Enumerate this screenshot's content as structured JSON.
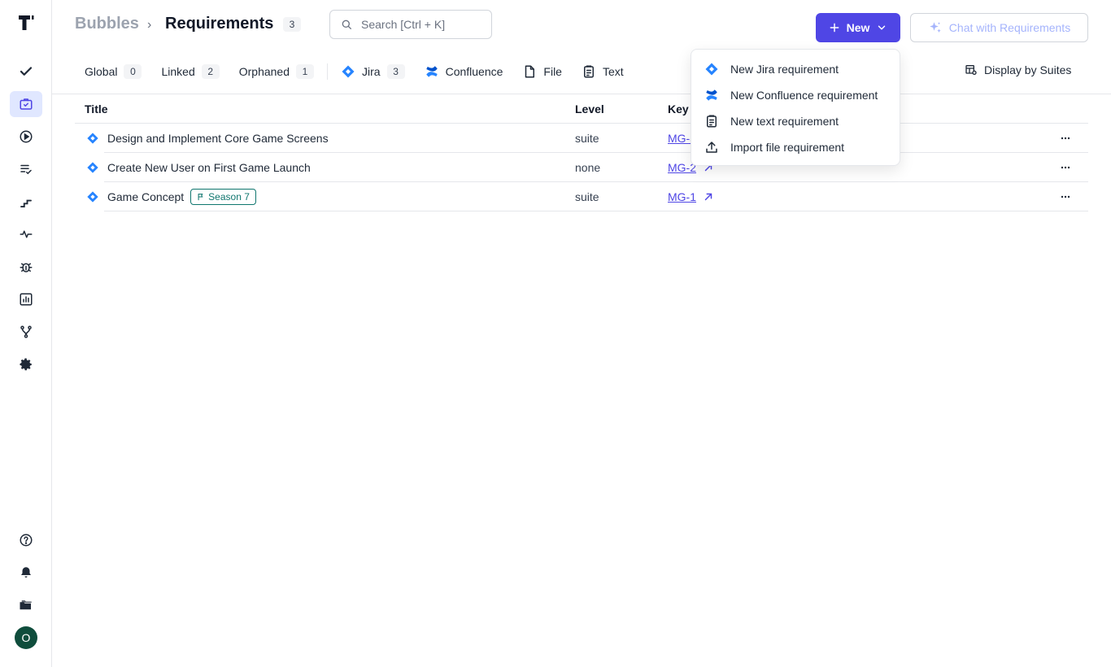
{
  "breadcrumb": {
    "parent": "Bubbles",
    "separator": "›",
    "current": "Requirements",
    "count": "3"
  },
  "search": {
    "placeholder": "Search [Ctrl + K]"
  },
  "actions": {
    "new_label": "New",
    "chat_label": "Chat with Requirements"
  },
  "tabs": [
    {
      "label": "Global",
      "count": "0"
    },
    {
      "label": "Linked",
      "count": "2"
    },
    {
      "label": "Orphaned",
      "count": "1"
    },
    {
      "label": "Jira",
      "count": "3",
      "icon": "jira-icon"
    },
    {
      "label": "Confluence",
      "icon": "confluence-icon"
    },
    {
      "label": "File",
      "icon": "file-icon"
    },
    {
      "label": "Text",
      "icon": "clipboard-icon"
    }
  ],
  "display_by": "Display by Suites",
  "table": {
    "headers": {
      "title": "Title",
      "level": "Level",
      "key": "Key"
    },
    "rows": [
      {
        "title": "Design and Implement Core Game Screens",
        "level": "suite",
        "key": "MG-3"
      },
      {
        "title": "Create New User on First Game Launch",
        "level": "none",
        "key": "MG-2"
      },
      {
        "title": "Game Concept",
        "tag": "Season 7",
        "level": "suite",
        "key": "MG-1"
      }
    ]
  },
  "dropdown": {
    "items": [
      {
        "label": "New Jira requirement",
        "icon": "jira-icon"
      },
      {
        "label": "New Confluence requirement",
        "icon": "confluence-icon"
      },
      {
        "label": "New text requirement",
        "icon": "clipboard-icon"
      },
      {
        "label": "Import file requirement",
        "icon": "upload-icon"
      }
    ]
  },
  "user": {
    "initial": "O",
    "avatar_color": "#0f4d3c"
  },
  "colors": {
    "accent": "#4f46e5",
    "jira": "#2684ff",
    "tag": "#0f766e"
  }
}
